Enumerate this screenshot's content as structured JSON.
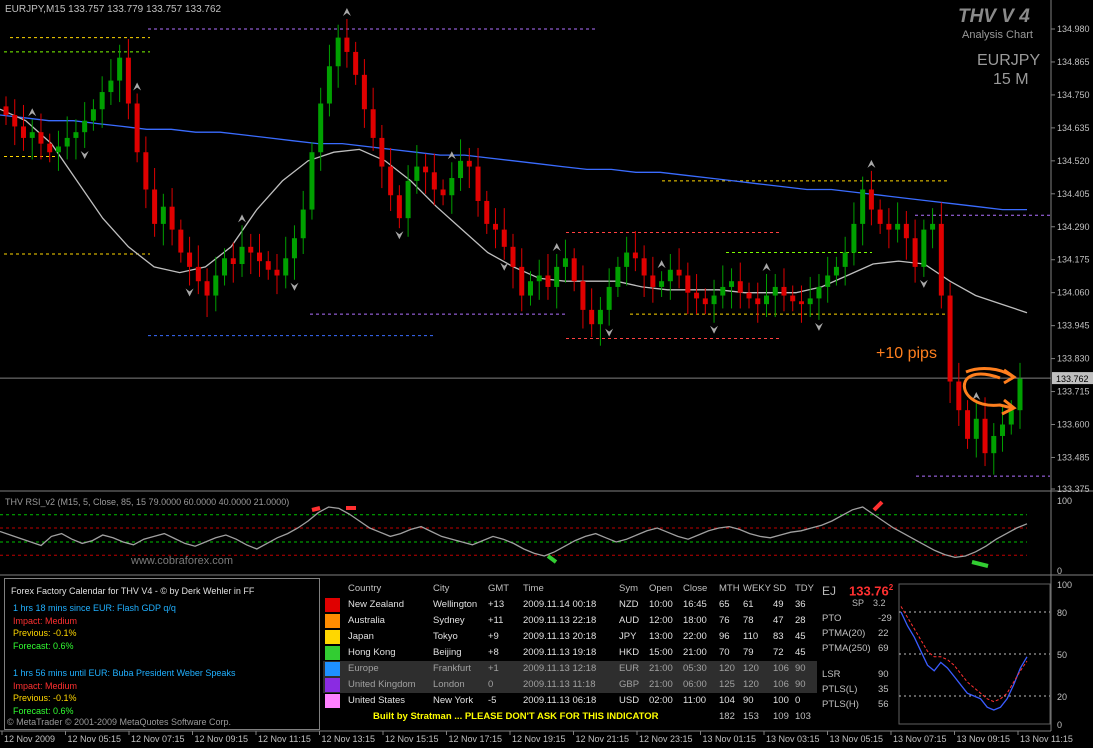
{
  "header": {
    "symbol_line": "EURJPY,M15  133.757 133.779 133.757 133.762",
    "brand": "THV V 4",
    "subtitle": "Analysis Chart",
    "pair": "EURJPY",
    "timeframe": "15 M",
    "annotation": "+10 pips",
    "current_price_label": "133.762",
    "watermark": "www.cobraforex.com"
  },
  "colors": {
    "bull": "#00a000",
    "bear": "#e00000",
    "ma_blue": "#3a6cff",
    "ma_grey": "#bfbfbf",
    "arrow": "#ff7f1e",
    "grid_green": "#00c000",
    "grid_red": "#c00000"
  },
  "chart_data": [
    {
      "type": "candlestick",
      "title": "EURJPY,M15",
      "y_ticks": [
        "134.980",
        "134.865",
        "134.750",
        "134.635",
        "134.520",
        "134.405",
        "134.290",
        "134.175",
        "134.060",
        "133.945",
        "133.830",
        "133.715",
        "133.600",
        "133.485",
        "133.375"
      ],
      "ylim": [
        133.375,
        134.98
      ],
      "x_ticks": [
        "12 Nov 2009",
        "12 Nov 05:15",
        "12 Nov 07:15",
        "12 Nov 09:15",
        "12 Nov 11:15",
        "12 Nov 13:15",
        "12 Nov 15:15",
        "12 Nov 17:15",
        "12 Nov 19:15",
        "12 Nov 21:15",
        "12 Nov 23:15",
        "13 Nov 01:15",
        "13 Nov 03:15",
        "13 Nov 05:15",
        "13 Nov 07:15",
        "13 Nov 09:15",
        "13 Nov 11:15"
      ],
      "current_price": 133.762,
      "close": [
        134.68,
        134.64,
        134.6,
        134.62,
        134.58,
        134.55,
        134.57,
        134.6,
        134.62,
        134.66,
        134.7,
        134.76,
        134.8,
        134.88,
        134.72,
        134.55,
        134.42,
        134.3,
        134.36,
        134.28,
        134.2,
        134.15,
        134.1,
        134.05,
        134.12,
        134.18,
        134.16,
        134.22,
        134.2,
        134.17,
        134.14,
        134.12,
        134.18,
        134.25,
        134.35,
        134.55,
        134.72,
        134.85,
        134.95,
        134.9,
        134.82,
        134.7,
        134.6,
        134.5,
        134.4,
        134.32,
        134.45,
        134.5,
        134.48,
        134.42,
        134.4,
        134.46,
        134.52,
        134.5,
        134.38,
        134.3,
        134.28,
        134.22,
        134.15,
        134.05,
        134.1,
        134.12,
        134.08,
        134.15,
        134.18,
        134.1,
        134.0,
        133.95,
        134.0,
        134.08,
        134.15,
        134.2,
        134.18,
        134.12,
        134.08,
        134.1,
        134.14,
        134.12,
        134.06,
        134.04,
        134.02,
        134.05,
        134.08,
        134.1,
        134.06,
        134.04,
        134.02,
        134.05,
        134.08,
        134.05,
        134.03,
        134.02,
        134.04,
        134.08,
        134.12,
        134.15,
        134.2,
        134.3,
        134.42,
        134.35,
        134.3,
        134.28,
        134.3,
        134.25,
        134.15,
        134.28,
        134.3,
        134.05,
        133.75,
        133.65,
        133.55,
        133.62,
        133.5,
        133.56,
        133.6,
        133.65,
        133.76
      ],
      "series": [
        {
          "name": "",
          "values": [
            134.68,
            134.67,
            134.66,
            134.66,
            134.65,
            134.64,
            134.63,
            134.63,
            134.62,
            134.62,
            134.61,
            134.6,
            134.59,
            134.58,
            134.58,
            134.57,
            134.56,
            134.55,
            134.54,
            134.54,
            134.53,
            134.52,
            134.51,
            134.5,
            134.49,
            134.49,
            134.48,
            134.48,
            134.47,
            134.46,
            134.45,
            134.44,
            134.43,
            134.42,
            134.42,
            134.41,
            134.4,
            134.39,
            134.38,
            134.37,
            134.36,
            134.35,
            134.35
          ]
        },
        {
          "name": "",
          "values": [
            134.7,
            134.66,
            134.58,
            134.45,
            134.32,
            134.22,
            134.15,
            134.13,
            134.15,
            134.22,
            134.35,
            134.45,
            134.52,
            134.55,
            134.56,
            134.52,
            134.45,
            134.36,
            134.28,
            134.2,
            134.15,
            134.11,
            134.1,
            134.1,
            134.1,
            134.08,
            134.07,
            134.07,
            134.07,
            134.06,
            134.06,
            134.06,
            134.08,
            134.12,
            134.16,
            134.17,
            134.16,
            134.1,
            134.05,
            134.02,
            133.99
          ]
        }
      ]
    },
    {
      "type": "line",
      "title": "THV RSI_v2  (M15, 5, Close, 85, 15 79.0000 60.0000 40.0000 21.0000)",
      "y_ticks": [
        "100",
        "0"
      ],
      "ylim": [
        0,
        100
      ],
      "levels": [
        79,
        60,
        40,
        21
      ],
      "values": [
        55,
        50,
        45,
        40,
        35,
        48,
        52,
        44,
        38,
        42,
        50,
        46,
        40,
        36,
        44,
        48,
        52,
        45,
        38,
        34,
        40,
        46,
        50,
        44,
        36,
        30,
        38,
        46,
        52,
        60,
        70,
        82,
        90,
        88,
        80,
        70,
        60,
        54,
        48,
        52,
        58,
        62,
        55,
        48,
        44,
        40,
        36,
        42,
        48,
        44,
        38,
        30,
        24,
        20,
        26,
        34,
        42,
        48,
        52,
        46,
        40,
        44,
        50,
        56,
        60,
        54,
        48,
        44,
        50,
        56,
        60,
        62,
        58,
        52,
        48,
        46,
        50,
        54,
        56,
        60,
        64,
        70,
        78,
        86,
        90,
        80,
        70,
        60,
        52,
        44,
        36,
        28,
        22,
        18,
        20,
        26,
        34,
        44,
        52,
        60,
        66
      ]
    },
    {
      "type": "line",
      "title": "EJ",
      "y_ticks": [
        "100",
        "80",
        "50",
        "20",
        "0"
      ],
      "ylim": [
        0,
        100
      ],
      "series": [
        {
          "name": "",
          "values": [
            80,
            70,
            62,
            52,
            42,
            38,
            44,
            40,
            34,
            28,
            22,
            20,
            18,
            12,
            10,
            12,
            18,
            28,
            40,
            48
          ]
        },
        {
          "name": "",
          "values": [
            84,
            76,
            68,
            60,
            52,
            48,
            48,
            46,
            42,
            36,
            30,
            26,
            22,
            18,
            16,
            18,
            22,
            30,
            38,
            45
          ]
        }
      ]
    }
  ],
  "calendar": {
    "title": "Forex Factory Calendar for THV V4 - © by Derk Wehler in FF",
    "event1": "1 hrs 18 mins since EUR: Flash GDP q/q",
    "impact1": "Impact: Medium",
    "previous1": "Previous: -0.1%",
    "forecast1": "Forecast: 0.6%",
    "event2": "1 hrs 56 mins until EUR: Buba President Weber Speaks",
    "impact2": "Impact: Medium",
    "previous2": "Previous: -0.1%",
    "forecast2": "Forecast: 0.6%",
    "copyright": "© MetaTrader © 2001-2009 MetaQuotes Software Corp."
  },
  "sessions": {
    "headers": [
      "Country",
      "City",
      "GMT",
      "Time",
      "Sym",
      "Open",
      "Close",
      "MTH",
      "WEKY",
      "SD",
      "TDY"
    ],
    "rows": [
      {
        "color": "#e00000",
        "country": "New Zealand",
        "city": "Wellington",
        "gmt": "+13",
        "time": "2009.11.14 00:18",
        "sym": "NZD",
        "open": "10:00",
        "close": "16:45",
        "mth": "65",
        "weky": "61",
        "sd": "49",
        "tdy": "36"
      },
      {
        "color": "#ff8c00",
        "country": "Australia",
        "city": "Sydney",
        "gmt": "+11",
        "time": "2009.11.13 22:18",
        "sym": "AUD",
        "open": "12:00",
        "close": "18:00",
        "mth": "76",
        "weky": "78",
        "sd": "47",
        "tdy": "28"
      },
      {
        "color": "#ffd700",
        "country": "Japan",
        "city": "Tokyo",
        "gmt": "+9",
        "time": "2009.11.13 20:18",
        "sym": "JPY",
        "open": "13:00",
        "close": "22:00",
        "mth": "96",
        "weky": "110",
        "sd": "83",
        "tdy": "45"
      },
      {
        "color": "#32cd32",
        "country": "Hong Kong",
        "city": "Beijing",
        "gmt": "+8",
        "time": "2009.11.13 19:18",
        "sym": "HKD",
        "open": "15:00",
        "close": "21:00",
        "mth": "70",
        "weky": "79",
        "sd": "72",
        "tdy": "45"
      },
      {
        "color": "#1e90ff",
        "country": "Europe",
        "city": "Frankfurt",
        "gmt": "+1",
        "time": "2009.11.13 12:18",
        "sym": "EUR",
        "open": "21:00",
        "close": "05:30",
        "mth": "120",
        "weky": "120",
        "sd": "106",
        "tdy": "90"
      },
      {
        "color": "#8a2be2",
        "country": "United Kingdom",
        "city": "London",
        "gmt": "0",
        "time": "2009.11.13 11:18",
        "sym": "GBP",
        "open": "21:00",
        "close": "06:00",
        "mth": "125",
        "weky": "120",
        "sd": "106",
        "tdy": "90"
      },
      {
        "color": "#ff80ff",
        "country": "United States",
        "city": "New York",
        "gmt": "-5",
        "time": "2009.11.13 06:18",
        "sym": "USD",
        "open": "02:00",
        "close": "11:00",
        "mth": "104",
        "weky": "90",
        "sd": "100",
        "tdy": "0"
      }
    ],
    "footer": "Built by Stratman ... PLEASE DON'T ASK FOR THIS INDICATOR",
    "totals": [
      "182",
      "153",
      "109",
      "103"
    ]
  },
  "ej": {
    "symbol": "EJ",
    "price": "133.76",
    "price_sup": "2",
    "sp_label": "SP",
    "sp_value": "3.2",
    "metrics": [
      {
        "label": "PTO",
        "value": "-29"
      },
      {
        "label": "PTMA(20)",
        "value": "22"
      },
      {
        "label": "PTMA(250)",
        "value": "69"
      },
      {
        "label": "LSR",
        "value": "90"
      },
      {
        "label": "PTLS(L)",
        "value": "35"
      },
      {
        "label": "PTLS(H)",
        "value": "56"
      }
    ]
  }
}
